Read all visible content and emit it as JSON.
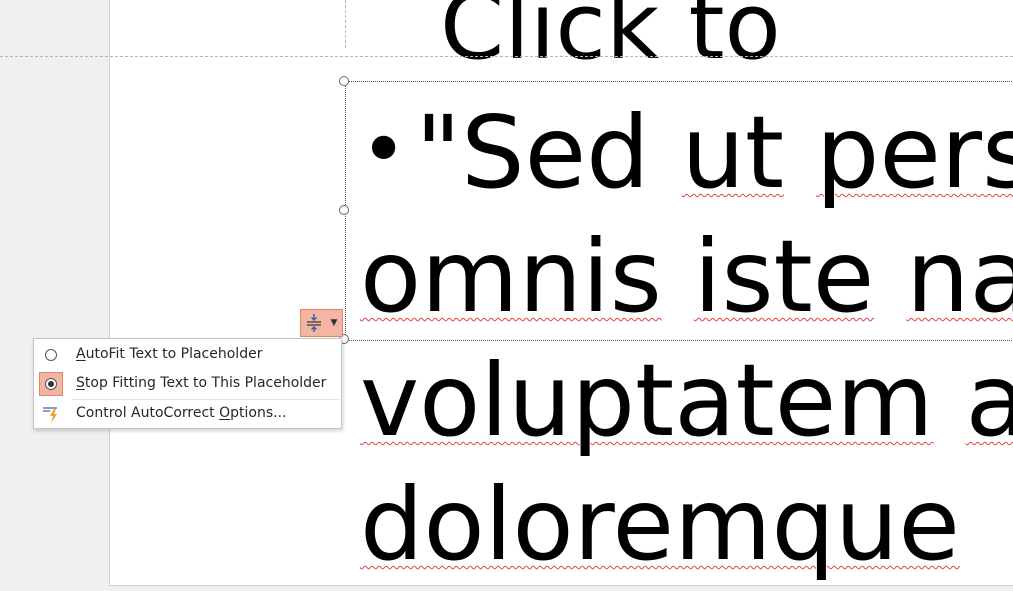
{
  "slide": {
    "title_fragment": "Click to",
    "body_lines": [
      {
        "bullet": "•",
        "words": [
          "\"Sed",
          "ut",
          "pers"
        ]
      },
      {
        "bullet": "",
        "words": [
          "omnis",
          "iste",
          "na"
        ]
      },
      {
        "bullet": "",
        "words": [
          "voluptatem",
          "a"
        ]
      },
      {
        "bullet": "",
        "words": [
          "doloremque"
        ]
      }
    ]
  },
  "autofit_button": {
    "icon": "autofit-options-icon",
    "dropdown_icon": "chevron-down-icon"
  },
  "menu": {
    "items": [
      {
        "accel": "A",
        "rest": "utoFit Text to Placeholder",
        "icon": "radio-unchecked-icon",
        "selected": false
      },
      {
        "accel": "S",
        "rest": "top Fitting Text to This Placeholder",
        "icon": "radio-checked-icon",
        "selected": true
      },
      {
        "prefix": "Control AutoCorrect ",
        "accel": "O",
        "rest": "ptions...",
        "icon": "autocorrect-lightning-icon"
      }
    ]
  },
  "colors": {
    "accent_fill": "#f4b6a2",
    "accent_border": "#e0866a",
    "spellcheck": "#e84040",
    "autocorrect_icon_orange": "#f0a030",
    "autocorrect_icon_blue": "#4a6aa8"
  }
}
